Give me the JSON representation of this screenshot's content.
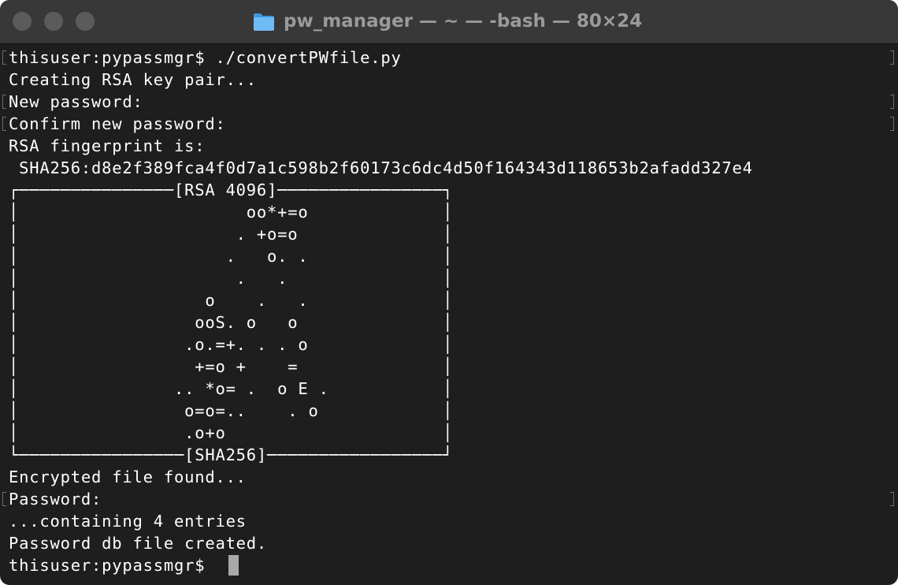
{
  "window": {
    "title": "pw_manager — ~ — -bash — 80×24"
  },
  "icons": {
    "folder": "folder-icon",
    "folder_color": "#4aa7f0"
  },
  "terminal": {
    "lines": [
      "thisuser:pypassmgr$ ./convertPWfile.py",
      "Creating RSA key pair...",
      "New password:",
      "Confirm new password:",
      "RSA fingerprint is:",
      " SHA256:d8e2f389fca4f0d7a1c598b2f60173c6dc4d50f164343d118653b2afadd327e4",
      "┌───────────────[RSA 4096]────────────────┐",
      "│                      oo*+=o             │",
      "│                     . +o=o              │",
      "│                    .   o. .             │",
      "│                     .   .               │",
      "│                  o    .   .             │",
      "│                 ooS. o   o              │",
      "│                .o.=+. . . o             │",
      "│                 +=o +    =              │",
      "│               .. *o= .  o E .           │",
      "│                o=o=..    . o            │",
      "│                .o+o                     │",
      "└────────────────[SHA256]─────────────────┘",
      "Encrypted file found...",
      "Password:",
      "...containing 4 entries",
      "Password db file created.",
      "thisuser:pypassmgr$ "
    ]
  }
}
